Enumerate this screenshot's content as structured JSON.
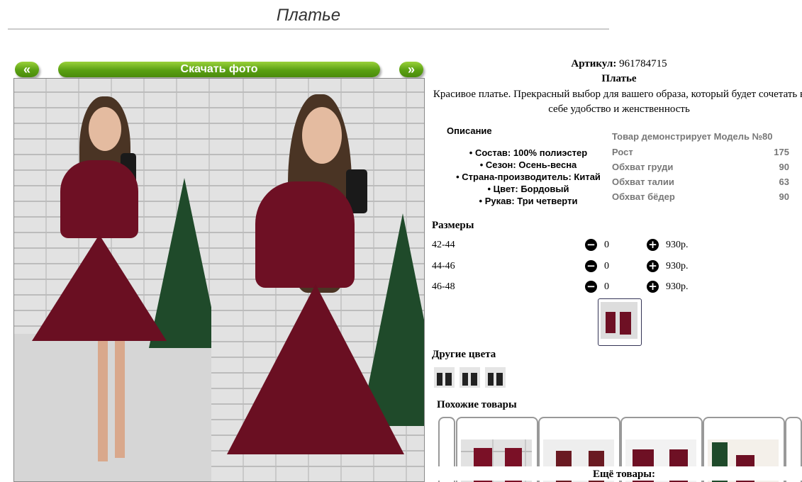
{
  "page": {
    "title": "Платье"
  },
  "gallery": {
    "prev_label": "«",
    "download_label": "Скачать фото",
    "next_label": "»"
  },
  "product": {
    "sku_label": "Артикул:",
    "sku_value": "961784715",
    "name": "Платье",
    "description": "Красивое платье. Прекрасный выбор для вашего образа, который будет сочетать в себе удобство и женственность"
  },
  "description_section": {
    "title": "Описание",
    "items": [
      "Состав: 100% полиэстер",
      "Сезон: Осень-весна",
      "Страна-производитель: Китай",
      "Цвет: Бордовый",
      "Рукав: Три четверти"
    ]
  },
  "model": {
    "heading": "Товар демонстрирует Модель №80",
    "rows": [
      {
        "label": "Рост",
        "value": "175"
      },
      {
        "label": "Обхват груди",
        "value": "90"
      },
      {
        "label": "Обхват талии",
        "value": "63"
      },
      {
        "label": "Обхват бёдер",
        "value": "90"
      }
    ]
  },
  "sizes": {
    "title": "Размеры",
    "rows": [
      {
        "size": "42-44",
        "qty": "0",
        "price": "930р."
      },
      {
        "size": "44-46",
        "qty": "0",
        "price": "930р."
      },
      {
        "size": "46-48",
        "qty": "0",
        "price": "930р."
      }
    ]
  },
  "other_colors": {
    "title": "Другие цвета"
  },
  "similar": {
    "title": "Похожие товары",
    "more_label": "Ещё товары:"
  },
  "colors": {
    "accent_green": "#5aa012",
    "dress": "#6e1024",
    "muted_text": "#777777"
  },
  "icons": {
    "minus": "minus-circle-icon",
    "plus": "plus-circle-icon"
  }
}
